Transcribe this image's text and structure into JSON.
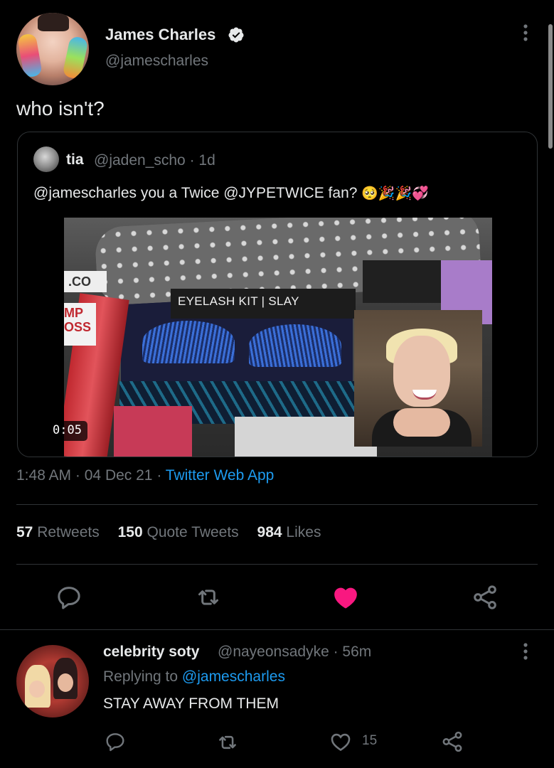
{
  "author": {
    "name": "James Charles",
    "handle": "@jamescharles",
    "verified": true,
    "avatar": "avatar"
  },
  "tweet": {
    "text": "who isn't?",
    "time": "1:48 AM",
    "date": "04 Dec 21",
    "source": "Twitter Web App",
    "separator": "·"
  },
  "quote": {
    "name": "tia",
    "handle": "@jaden_scho",
    "age": "· 1d",
    "text_mention": "@jamescharles",
    "text_mid": " you a Twice ",
    "text_mention2": "@JYPETWICE",
    "text_end": " fan? ",
    "emojis": "🥺🎉🎉💞",
    "video": {
      "duration": "0:05",
      "box_label": "EYELASH KIT | SLAY",
      "co_label": ".CO",
      "card_label": "MP\nOSS"
    }
  },
  "stats": {
    "retweets_count": "57",
    "retweets_label": "Retweets",
    "quotes_count": "150",
    "quotes_label": "Quote Tweets",
    "likes_count": "984",
    "likes_label": "Likes"
  },
  "actions": {
    "reply": "reply-icon",
    "retweet": "retweet-icon",
    "like": "heart-icon",
    "share": "share-icon",
    "liked": true,
    "like_color": "#f91880"
  },
  "reply": {
    "name": "celebrity soty",
    "handle": "@nayeonsadyke",
    "age": "· 56m",
    "replying_prefix": "Replying to ",
    "replying_to": "@jamescharles",
    "text": "STAY AWAY FROM THEM",
    "like_count": "15"
  },
  "colors": {
    "background": "#000000",
    "text": "#e7e9ea",
    "muted": "#71767b",
    "link": "#1d9bf0",
    "like": "#f91880"
  }
}
